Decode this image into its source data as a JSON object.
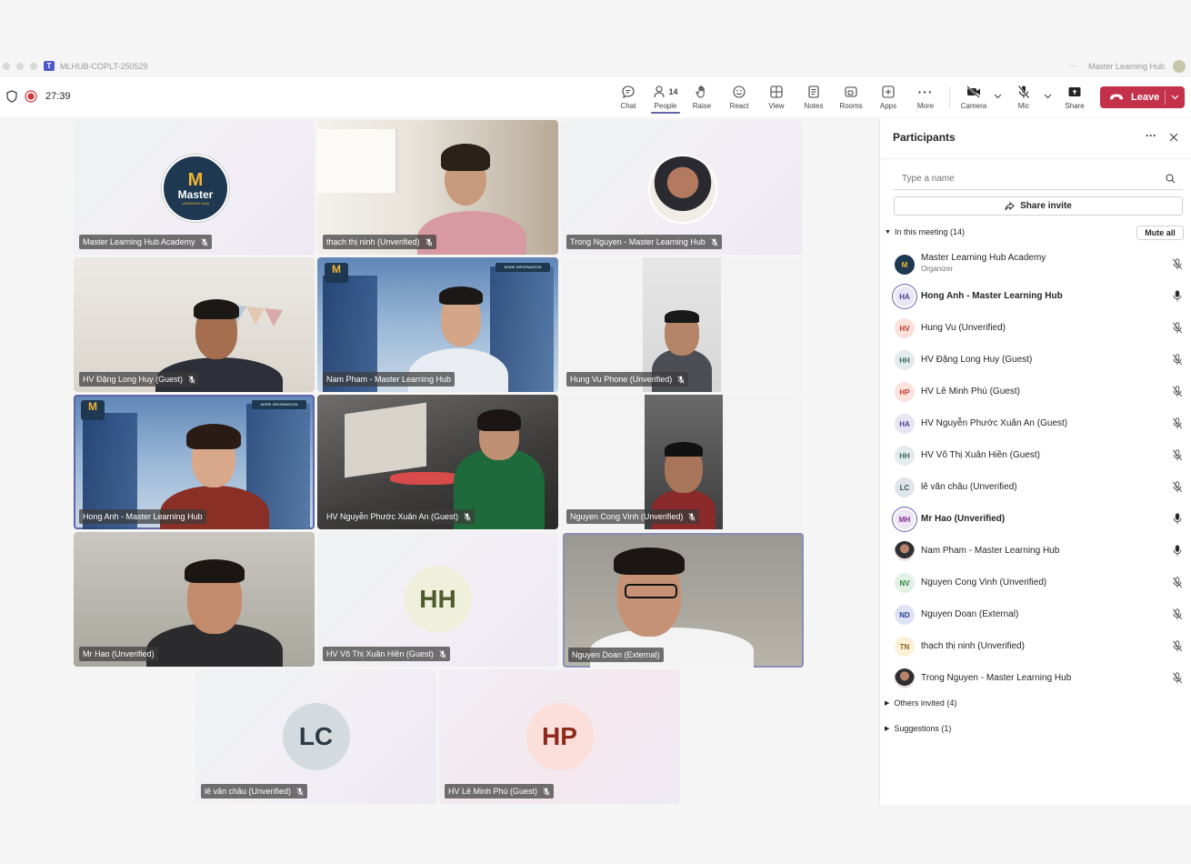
{
  "window": {
    "title": "MLHUB-COPLT-250529",
    "app_right": "Master Learning Hub",
    "more": "···"
  },
  "meeting": {
    "timer": "27:39"
  },
  "toolbar": {
    "chat": "Chat",
    "people": "People",
    "people_count": "14",
    "raise": "Raise",
    "react": "React",
    "view": "View",
    "notes": "Notes",
    "rooms": "Rooms",
    "apps": "Apps",
    "more": "More",
    "camera": "Camera",
    "mic": "Mic",
    "share": "Share",
    "leave": "Leave"
  },
  "tiles": [
    {
      "name": "Master Learning Hub Academy",
      "kind": "logo",
      "logo_top": "M",
      "logo_text": "Master",
      "logo_sub": "LEARNING HUB"
    },
    {
      "name": "thạch thị ninh (Unverified)",
      "kind": "video"
    },
    {
      "name": "Trong Nguyen - Master Learning Hub",
      "kind": "photo"
    },
    {
      "name": "HV Đặng Long Huy (Guest)",
      "kind": "video"
    },
    {
      "name": "Nam Pham - Master Learning Hub",
      "kind": "video",
      "banner": "MORE INFORMATION"
    },
    {
      "name": "Hung Vu Phone (Unverified)",
      "kind": "video"
    },
    {
      "name": "Hong Anh - Master Learning Hub",
      "kind": "video",
      "banner": "MORE INFORMATION"
    },
    {
      "name": "HV Nguyễn Phước Xuân An (Guest)",
      "kind": "video"
    },
    {
      "name": "Nguyen Cong Vinh (Unverified)",
      "kind": "video"
    },
    {
      "name": "Mr Hao (Unverified)",
      "kind": "video"
    },
    {
      "name": "HV Võ Thị Xuân Hiền (Guest)",
      "kind": "avatar",
      "initials": "HH"
    },
    {
      "name": "Nguyen Doan (External)",
      "kind": "video"
    },
    {
      "name": "lê văn châu (Unverified)",
      "kind": "avatar",
      "initials": "LC"
    },
    {
      "name": "HV Lê Minh Phú (Guest)",
      "kind": "avatar",
      "initials": "HP"
    }
  ],
  "panel": {
    "title": "Participants",
    "search_placeholder": "Type a name",
    "share_invite": "Share invite",
    "in_meeting": "In this meeting (14)",
    "mute_all": "Mute all",
    "others_invited": "Others invited (4)",
    "suggestions": "Suggestions (1)",
    "participants": [
      {
        "name": "Master Learning Hub Academy",
        "sub": "Organizer",
        "initials": "M",
        "muted": true
      },
      {
        "name": "Hong Anh - Master Learning Hub",
        "initials": "HA",
        "muted": false,
        "bold": true
      },
      {
        "name": "Hung Vu (Unverified)",
        "initials": "HV",
        "muted": true
      },
      {
        "name": "HV Đặng Long Huy (Guest)",
        "initials": "HH",
        "muted": true
      },
      {
        "name": "HV Lê Minh Phú (Guest)",
        "initials": "HP",
        "muted": true
      },
      {
        "name": "HV Nguyễn Phước Xuân An (Guest)",
        "initials": "HA",
        "muted": true
      },
      {
        "name": "HV Võ Thị Xuân Hiền (Guest)",
        "initials": "HH",
        "muted": true
      },
      {
        "name": "lê văn châu (Unverified)",
        "initials": "LC",
        "muted": true
      },
      {
        "name": "Mr Hao (Unverified)",
        "initials": "MH",
        "muted": false,
        "bold": true
      },
      {
        "name": "Nam Pham - Master Learning Hub",
        "initials": "",
        "muted": false
      },
      {
        "name": "Nguyen Cong Vinh (Unverified)",
        "initials": "NV",
        "muted": true
      },
      {
        "name": "Nguyen Doan (External)",
        "initials": "ND",
        "muted": true
      },
      {
        "name": "thạch thị ninh (Unverified)",
        "initials": "TN",
        "muted": true
      },
      {
        "name": "Trong Nguyen - Master Learning Hub",
        "initials": "",
        "muted": true
      }
    ]
  },
  "colors": {
    "accent": "#6264a7",
    "leave": "#c4314b",
    "record": "#d13438"
  }
}
